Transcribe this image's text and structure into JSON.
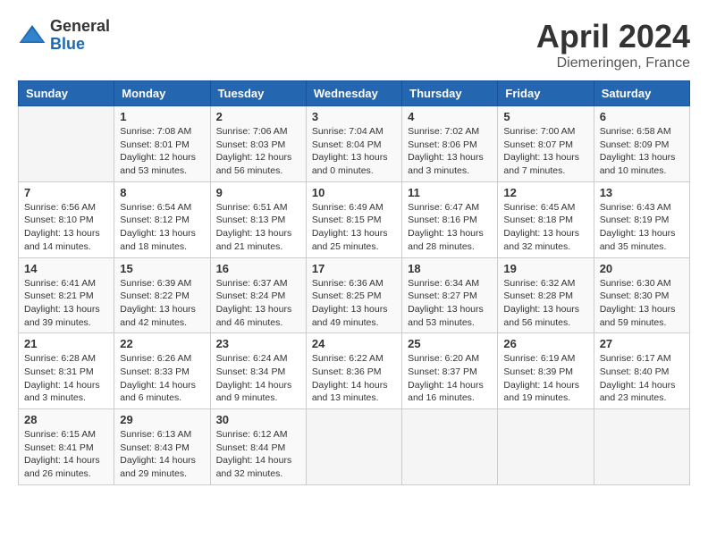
{
  "header": {
    "logo_general": "General",
    "logo_blue": "Blue",
    "month": "April 2024",
    "location": "Diemeringen, France"
  },
  "columns": [
    "Sunday",
    "Monday",
    "Tuesday",
    "Wednesday",
    "Thursday",
    "Friday",
    "Saturday"
  ],
  "weeks": [
    [
      {
        "day": "",
        "info": ""
      },
      {
        "day": "1",
        "info": "Sunrise: 7:08 AM\nSunset: 8:01 PM\nDaylight: 12 hours\nand 53 minutes."
      },
      {
        "day": "2",
        "info": "Sunrise: 7:06 AM\nSunset: 8:03 PM\nDaylight: 12 hours\nand 56 minutes."
      },
      {
        "day": "3",
        "info": "Sunrise: 7:04 AM\nSunset: 8:04 PM\nDaylight: 13 hours\nand 0 minutes."
      },
      {
        "day": "4",
        "info": "Sunrise: 7:02 AM\nSunset: 8:06 PM\nDaylight: 13 hours\nand 3 minutes."
      },
      {
        "day": "5",
        "info": "Sunrise: 7:00 AM\nSunset: 8:07 PM\nDaylight: 13 hours\nand 7 minutes."
      },
      {
        "day": "6",
        "info": "Sunrise: 6:58 AM\nSunset: 8:09 PM\nDaylight: 13 hours\nand 10 minutes."
      }
    ],
    [
      {
        "day": "7",
        "info": "Sunrise: 6:56 AM\nSunset: 8:10 PM\nDaylight: 13 hours\nand 14 minutes."
      },
      {
        "day": "8",
        "info": "Sunrise: 6:54 AM\nSunset: 8:12 PM\nDaylight: 13 hours\nand 18 minutes."
      },
      {
        "day": "9",
        "info": "Sunrise: 6:51 AM\nSunset: 8:13 PM\nDaylight: 13 hours\nand 21 minutes."
      },
      {
        "day": "10",
        "info": "Sunrise: 6:49 AM\nSunset: 8:15 PM\nDaylight: 13 hours\nand 25 minutes."
      },
      {
        "day": "11",
        "info": "Sunrise: 6:47 AM\nSunset: 8:16 PM\nDaylight: 13 hours\nand 28 minutes."
      },
      {
        "day": "12",
        "info": "Sunrise: 6:45 AM\nSunset: 8:18 PM\nDaylight: 13 hours\nand 32 minutes."
      },
      {
        "day": "13",
        "info": "Sunrise: 6:43 AM\nSunset: 8:19 PM\nDaylight: 13 hours\nand 35 minutes."
      }
    ],
    [
      {
        "day": "14",
        "info": "Sunrise: 6:41 AM\nSunset: 8:21 PM\nDaylight: 13 hours\nand 39 minutes."
      },
      {
        "day": "15",
        "info": "Sunrise: 6:39 AM\nSunset: 8:22 PM\nDaylight: 13 hours\nand 42 minutes."
      },
      {
        "day": "16",
        "info": "Sunrise: 6:37 AM\nSunset: 8:24 PM\nDaylight: 13 hours\nand 46 minutes."
      },
      {
        "day": "17",
        "info": "Sunrise: 6:36 AM\nSunset: 8:25 PM\nDaylight: 13 hours\nand 49 minutes."
      },
      {
        "day": "18",
        "info": "Sunrise: 6:34 AM\nSunset: 8:27 PM\nDaylight: 13 hours\nand 53 minutes."
      },
      {
        "day": "19",
        "info": "Sunrise: 6:32 AM\nSunset: 8:28 PM\nDaylight: 13 hours\nand 56 minutes."
      },
      {
        "day": "20",
        "info": "Sunrise: 6:30 AM\nSunset: 8:30 PM\nDaylight: 13 hours\nand 59 minutes."
      }
    ],
    [
      {
        "day": "21",
        "info": "Sunrise: 6:28 AM\nSunset: 8:31 PM\nDaylight: 14 hours\nand 3 minutes."
      },
      {
        "day": "22",
        "info": "Sunrise: 6:26 AM\nSunset: 8:33 PM\nDaylight: 14 hours\nand 6 minutes."
      },
      {
        "day": "23",
        "info": "Sunrise: 6:24 AM\nSunset: 8:34 PM\nDaylight: 14 hours\nand 9 minutes."
      },
      {
        "day": "24",
        "info": "Sunrise: 6:22 AM\nSunset: 8:36 PM\nDaylight: 14 hours\nand 13 minutes."
      },
      {
        "day": "25",
        "info": "Sunrise: 6:20 AM\nSunset: 8:37 PM\nDaylight: 14 hours\nand 16 minutes."
      },
      {
        "day": "26",
        "info": "Sunrise: 6:19 AM\nSunset: 8:39 PM\nDaylight: 14 hours\nand 19 minutes."
      },
      {
        "day": "27",
        "info": "Sunrise: 6:17 AM\nSunset: 8:40 PM\nDaylight: 14 hours\nand 23 minutes."
      }
    ],
    [
      {
        "day": "28",
        "info": "Sunrise: 6:15 AM\nSunset: 8:41 PM\nDaylight: 14 hours\nand 26 minutes."
      },
      {
        "day": "29",
        "info": "Sunrise: 6:13 AM\nSunset: 8:43 PM\nDaylight: 14 hours\nand 29 minutes."
      },
      {
        "day": "30",
        "info": "Sunrise: 6:12 AM\nSunset: 8:44 PM\nDaylight: 14 hours\nand 32 minutes."
      },
      {
        "day": "",
        "info": ""
      },
      {
        "day": "",
        "info": ""
      },
      {
        "day": "",
        "info": ""
      },
      {
        "day": "",
        "info": ""
      }
    ]
  ]
}
